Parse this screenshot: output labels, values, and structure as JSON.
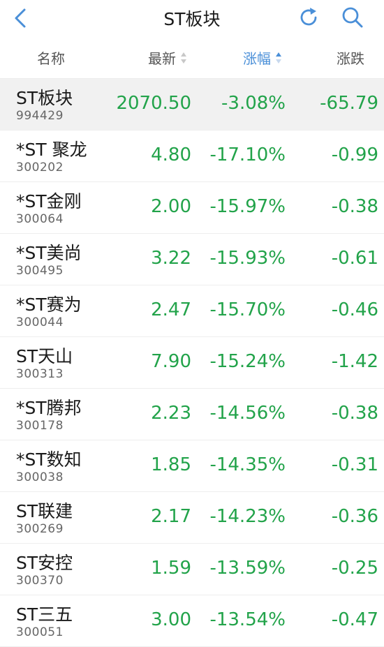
{
  "header": {
    "title": "ST板块"
  },
  "columns": {
    "name": "名称",
    "latest": "最新",
    "change_pct": "涨幅",
    "change": "涨跌"
  },
  "icons": {
    "back": "chevron-left-icon",
    "refresh": "refresh-icon",
    "search": "search-icon"
  },
  "colors": {
    "accent": "#4a8fd8",
    "down": "#22a34a"
  },
  "rows": [
    {
      "name": "ST板块",
      "code": "994429",
      "latest": "2070.50",
      "pct": "-3.08%",
      "chg": "-65.79"
    },
    {
      "name": "*ST 聚龙",
      "code": "300202",
      "latest": "4.80",
      "pct": "-17.10%",
      "chg": "-0.99"
    },
    {
      "name": "*ST金刚",
      "code": "300064",
      "latest": "2.00",
      "pct": "-15.97%",
      "chg": "-0.38"
    },
    {
      "name": "*ST美尚",
      "code": "300495",
      "latest": "3.22",
      "pct": "-15.93%",
      "chg": "-0.61"
    },
    {
      "name": "*ST赛为",
      "code": "300044",
      "latest": "2.47",
      "pct": "-15.70%",
      "chg": "-0.46"
    },
    {
      "name": "ST天山",
      "code": "300313",
      "latest": "7.90",
      "pct": "-15.24%",
      "chg": "-1.42"
    },
    {
      "name": "*ST腾邦",
      "code": "300178",
      "latest": "2.23",
      "pct": "-14.56%",
      "chg": "-0.38"
    },
    {
      "name": "*ST数知",
      "code": "300038",
      "latest": "1.85",
      "pct": "-14.35%",
      "chg": "-0.31"
    },
    {
      "name": "ST联建",
      "code": "300269",
      "latest": "2.17",
      "pct": "-14.23%",
      "chg": "-0.36"
    },
    {
      "name": "ST安控",
      "code": "300370",
      "latest": "1.59",
      "pct": "-13.59%",
      "chg": "-0.25"
    },
    {
      "name": "ST三五",
      "code": "300051",
      "latest": "3.00",
      "pct": "-13.54%",
      "chg": "-0.47"
    }
  ]
}
